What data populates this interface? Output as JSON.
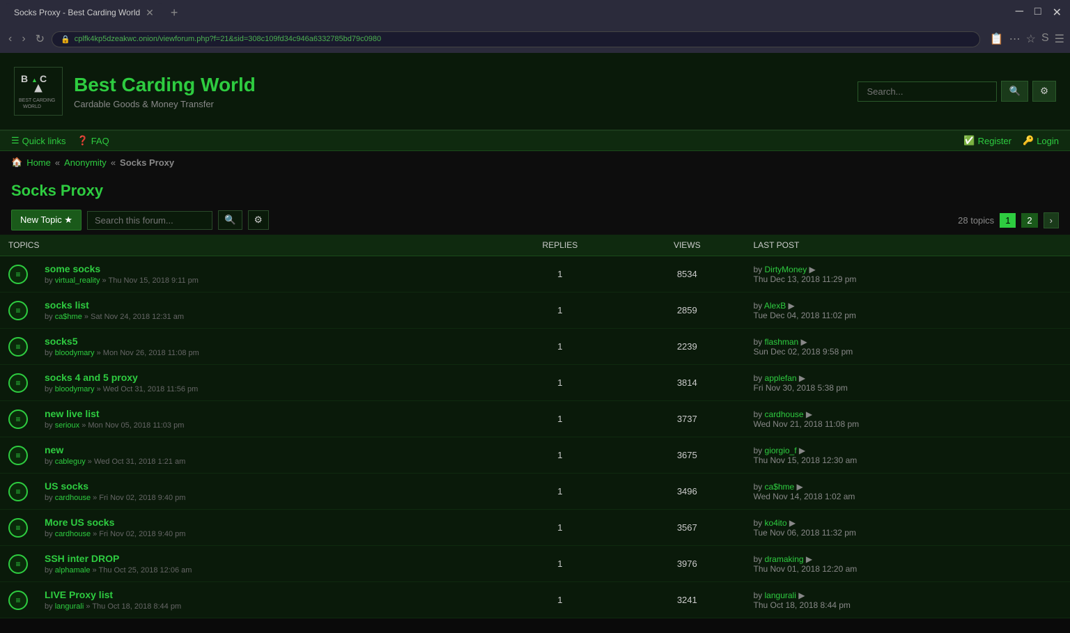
{
  "browser": {
    "tab_title": "Socks Proxy - Best Carding World",
    "url": "cplfk4kp5dzeakwc.onion/viewforum.php?f=21&sid=308c109fd34c946a6332785bd79c0980",
    "nav_back": "‹",
    "nav_forward": "›",
    "nav_refresh": "↻",
    "new_tab_label": "+"
  },
  "site": {
    "logo_text": "BCW BEST CARDING WORLD",
    "title": "Best Carding World",
    "subtitle": "Cardable Goods & Money Transfer",
    "search_placeholder": "Search...",
    "search_btn_label": "🔍",
    "settings_btn_label": "⚙"
  },
  "navbar": {
    "quicklinks_label": "Quick links",
    "faq_label": "FAQ",
    "register_label": "Register",
    "login_label": "Login"
  },
  "breadcrumb": {
    "home": "Home",
    "anonymity": "Anonymity",
    "current": "Socks Proxy"
  },
  "forum": {
    "title": "Socks Proxy",
    "new_topic_label": "New Topic ★",
    "search_placeholder": "Search this forum...",
    "topics_count": "28 topics",
    "current_page": "1",
    "next_page": "2"
  },
  "table": {
    "col_topics": "TOPICS",
    "col_replies": "REPLIES",
    "col_views": "VIEWS",
    "col_lastpost": "LAST POST"
  },
  "topics": [
    {
      "title": "some socks",
      "author": "virtual_reality",
      "date": "Thu Nov 15, 2018 9:11 pm",
      "replies": "1",
      "views": "8534",
      "last_by": "DirtyMoney",
      "last_date": "Thu Dec 13, 2018 11:29 pm"
    },
    {
      "title": "socks list",
      "author": "ca$hme",
      "date": "Sat Nov 24, 2018 12:31 am",
      "replies": "1",
      "views": "2859",
      "last_by": "AlexB",
      "last_date": "Tue Dec 04, 2018 11:02 pm"
    },
    {
      "title": "socks5",
      "author": "bloodymary",
      "date": "Mon Nov 26, 2018 11:08 pm",
      "replies": "1",
      "views": "2239",
      "last_by": "flashman",
      "last_date": "Sun Dec 02, 2018 9:58 pm"
    },
    {
      "title": "socks 4 and 5 proxy",
      "author": "bloodymary",
      "date": "Wed Oct 31, 2018 11:56 pm",
      "replies": "1",
      "views": "3814",
      "last_by": "applefan",
      "last_date": "Fri Nov 30, 2018 5:38 pm"
    },
    {
      "title": "new live list",
      "author": "serioux",
      "date": "Mon Nov 05, 2018 11:03 pm",
      "replies": "1",
      "views": "3737",
      "last_by": "cardhouse",
      "last_date": "Wed Nov 21, 2018 11:08 pm"
    },
    {
      "title": "new",
      "author": "cableguy",
      "date": "Wed Oct 31, 2018 1:21 am",
      "replies": "1",
      "views": "3675",
      "last_by": "giorgio_f",
      "last_date": "Thu Nov 15, 2018 12:30 am"
    },
    {
      "title": "US socks",
      "author": "cardhouse",
      "date": "Fri Nov 02, 2018 9:40 pm",
      "replies": "1",
      "views": "3496",
      "last_by": "ca$hme",
      "last_date": "Wed Nov 14, 2018 1:02 am"
    },
    {
      "title": "More US socks",
      "author": "cardhouse",
      "date": "Fri Nov 02, 2018 9:40 pm",
      "replies": "1",
      "views": "3567",
      "last_by": "ko4ito",
      "last_date": "Tue Nov 06, 2018 11:32 pm"
    },
    {
      "title": "SSH inter DROP",
      "author": "alphamale",
      "date": "Thu Oct 25, 2018 12:06 am",
      "replies": "1",
      "views": "3976",
      "last_by": "dramaking",
      "last_date": "Thu Nov 01, 2018 12:20 am"
    },
    {
      "title": "LIVE Proxy list",
      "author": "langurali",
      "date": "Thu Oct 18, 2018 8:44 pm",
      "replies": "1",
      "views": "3241",
      "last_by": "langurali",
      "last_date": "Thu Oct 18, 2018 8:44 pm"
    }
  ]
}
